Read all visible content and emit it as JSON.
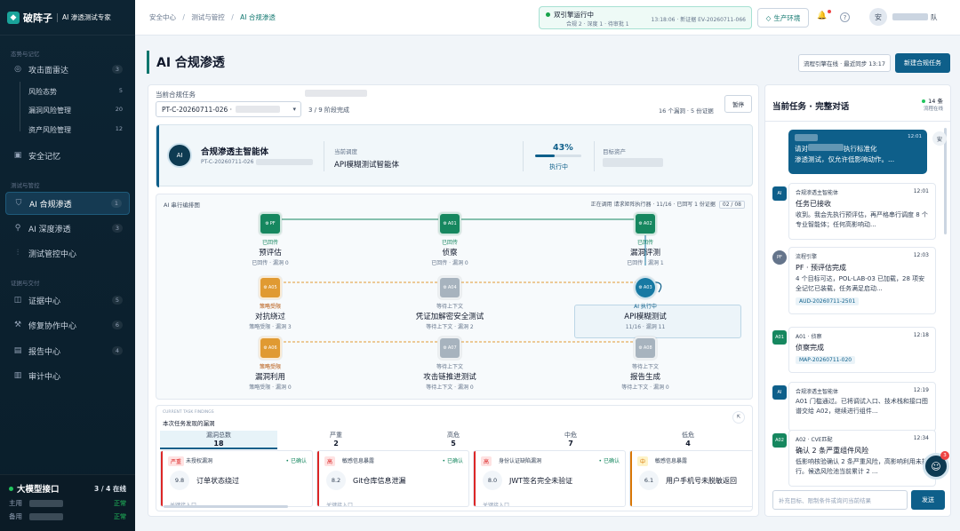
{
  "app": {
    "name": "破阵子",
    "subtitle": "AI 渗透测试专家",
    "logo_glyph": "◆"
  },
  "sidebar": {
    "sections": [
      "态势与记忆",
      "测试与管控",
      "证据与交付"
    ],
    "items": [
      {
        "label": "攻击面雷达",
        "icon": "radar-icon",
        "glyph": "◎",
        "count": "3"
      },
      {
        "label": "安全记忆",
        "icon": "memory-icon",
        "glyph": "▣",
        "count": ""
      },
      {
        "label": "AI 合规渗透",
        "icon": "shield-icon",
        "glyph": "⛉",
        "count": "1"
      },
      {
        "label": "AI 深度渗透",
        "icon": "ai-icon",
        "glyph": "⚲",
        "count": "3"
      },
      {
        "label": "测试管控中心",
        "icon": "control-icon",
        "glyph": "⫶",
        "count": ""
      },
      {
        "label": "证据中心",
        "icon": "evidence-icon",
        "glyph": "◫",
        "count": "5"
      },
      {
        "label": "修复协作中心",
        "icon": "wrench-icon",
        "glyph": "⚒",
        "count": "6"
      },
      {
        "label": "报告中心",
        "icon": "report-icon",
        "glyph": "▤",
        "count": "4"
      },
      {
        "label": "审计中心",
        "icon": "audit-icon",
        "glyph": "▥",
        "count": ""
      }
    ],
    "sub_items": [
      {
        "label": "风险态势",
        "count": "5"
      },
      {
        "label": "漏洞风险管理",
        "count": "20"
      },
      {
        "label": "资产风险管理",
        "count": "12"
      }
    ],
    "llm": {
      "title": "大模型接口",
      "online": "3 / 4 在线",
      "primary": "主用",
      "backup": "备用",
      "status": "正常"
    }
  },
  "topbar": {
    "crumbs": [
      "安全中心",
      "测试与管控",
      "AI 合规渗透"
    ],
    "crumb_sep": "/",
    "engine_title": "双引擎运行中",
    "engine_detail": "合规 2 · 深度 1 · 待审批 1",
    "engine_right": "13:18:06 · 新证据 EV-20260711-066",
    "env": "生产环境",
    "env_glyph": "◇",
    "bell_glyph": "🔔",
    "help_glyph": "?",
    "user_avatar": "安",
    "user_suffix": "队"
  },
  "page": {
    "title": "AI 合规渗透",
    "sync_btn": "流程引擎在线 · 最近同步 13:17",
    "new_btn": "新建合规任务"
  },
  "task": {
    "label": "当前合规任务",
    "select_value": "PT-C-20260711-026 ·",
    "chevron": "▾",
    "phase": "3 / 9 阶段完成",
    "evidence": "16 个漏洞 · 5 份证据",
    "pause": "暂停"
  },
  "agent": {
    "icon": "AI",
    "name": "合规渗透主智能体",
    "id": "PT-C-20260711-026 ·",
    "sched_label": "当前调度",
    "sched_value": "API模糊测试智能体",
    "pct_text": "43%",
    "progress": 0.43,
    "running": "执行中",
    "target_label": "目标资产"
  },
  "orchestration": {
    "title": "AI 串行编排图",
    "status": "正在调用 请求矩阵执行器 · 11/16 · 已回写 1 份证据",
    "page": "02 / 08",
    "node_glyph": "⚙",
    "nodes": [
      {
        "code": "PF",
        "state": "已回传",
        "name": "预评估",
        "sub": "已回传 · 漏洞 0",
        "color": "green"
      },
      {
        "code": "A01",
        "state": "已回传",
        "name": "侦察",
        "sub": "已回传 · 漏洞 0",
        "color": "green"
      },
      {
        "code": "A02",
        "state": "已回传",
        "name": "漏洞评测",
        "sub": "已回传 · 漏洞 1",
        "color": "green"
      },
      {
        "code": "A05",
        "state": "策略受限",
        "name": "对抗绕过",
        "sub": "策略受限 · 漏洞 3",
        "color": "orange"
      },
      {
        "code": "A04",
        "state": "等待上下文",
        "name": "凭证加解密安全测试",
        "sub": "等待上下文 · 漏洞 2",
        "color": "gray"
      },
      {
        "code": "A03",
        "state": "AI 执行中",
        "name": "API模糊测试",
        "sub": "11/16 · 漏洞 11",
        "color": "blue"
      },
      {
        "code": "A06",
        "state": "策略受限",
        "name": "漏洞利用",
        "sub": "策略受限 · 漏洞 0",
        "color": "orange"
      },
      {
        "code": "A07",
        "state": "等待上下文",
        "name": "攻击链推进测试",
        "sub": "等待上下文 · 漏洞 0",
        "color": "gray"
      },
      {
        "code": "A08",
        "state": "等待上下文",
        "name": "报告生成",
        "sub": "等待上下文 · 漏洞 0",
        "color": "gray"
      }
    ]
  },
  "findings": {
    "caption": "CURRENT TASK FINDINGS",
    "title": "本次任务发现的漏洞",
    "expand_glyph": "⇱",
    "severities": [
      {
        "label": "漏洞总数",
        "value": "18"
      },
      {
        "label": "严重",
        "value": "2"
      },
      {
        "label": "高危",
        "value": "5"
      },
      {
        "label": "中危",
        "value": "7"
      },
      {
        "label": "低危",
        "value": "4"
      }
    ],
    "cards": [
      {
        "tag": "严重",
        "type": "未授权漏洞",
        "ok": "• 已确认",
        "score": "9.8",
        "title": "订单状态绕过",
        "cut": "关键接入口",
        "color": "#dc2626",
        "bg": "#fee2e2"
      },
      {
        "tag": "高",
        "type": "敏感信息暴露",
        "ok": "• 已确认",
        "score": "8.2",
        "title": "Git仓库信息泄漏",
        "cut": "关键接入口",
        "color": "#dc2626",
        "bg": "#fee2e2"
      },
      {
        "tag": "高",
        "type": "身份认证缺陷漏洞",
        "ok": "• 已确认",
        "score": "8.0",
        "title": "JWT签名完全未验证",
        "cut": "关键接入口",
        "color": "#dc2626",
        "bg": "#fee2e2"
      },
      {
        "tag": "中",
        "type": "敏感信息暴露",
        "ok": "• 已确认",
        "score": "6.1",
        "title": "用户手机号未脱敏返回",
        "cut": "",
        "color": "#d97706",
        "bg": "#fef3c7"
      }
    ]
  },
  "chat": {
    "title": "当前任务 · 完整对话",
    "count": "14 条",
    "count_sub": "流程在线",
    "user_msg": {
      "time": "12:01",
      "text1": "执行标准化",
      "text2": "渗透测试，仅允许低影响动作。...",
      "prefix": "请对",
      "avatar": "安"
    },
    "messages": [
      {
        "avatar": "AI",
        "color": "#0e5f8a",
        "from": "合规渗透主智能体",
        "time": "12:01",
        "title": "任务已接收",
        "body": "收到。我会先执行预评估，再严格串行调度 8 个专业智能体；任何高影响动...",
        "ref": ""
      },
      {
        "avatar": "PF",
        "color": "#64748b",
        "from": "流程引擎",
        "time": "12:03",
        "title": "PF · 预评估完成",
        "body": "4 个目标可达，POL-LAB-03 已加载，28 项安全记忆已装载，任务满足启动...",
        "ref": "AUD-20260711-2501"
      },
      {
        "avatar": "A01",
        "color": "#16875f",
        "from": "A01 · 侦察",
        "time": "12:18",
        "title": "侦察完成",
        "body": "",
        "ref": "MAP-20260711-020"
      },
      {
        "avatar": "AI",
        "color": "#0e5f8a",
        "from": "合规渗透主智能体",
        "time": "12:19",
        "title": "",
        "body": "A01 门槛通过。已将调试入口、技术栈和接口图谱交给 A02，继续进行组件...",
        "ref": ""
      },
      {
        "avatar": "A02",
        "color": "#16875f",
        "from": "A02 · CVE匹配",
        "time": "12:34",
        "title": "确认 2 条严重组件风险",
        "body": "低影响核验确认 2 条严重风险，高影响利用未执行。候选风险池当前累计 2 ...",
        "ref": ""
      }
    ],
    "input_placeholder": "补充目标、限制条件或询问当前结果",
    "send": "发送"
  },
  "fab": {
    "glyph": "☺",
    "badge": "3"
  }
}
